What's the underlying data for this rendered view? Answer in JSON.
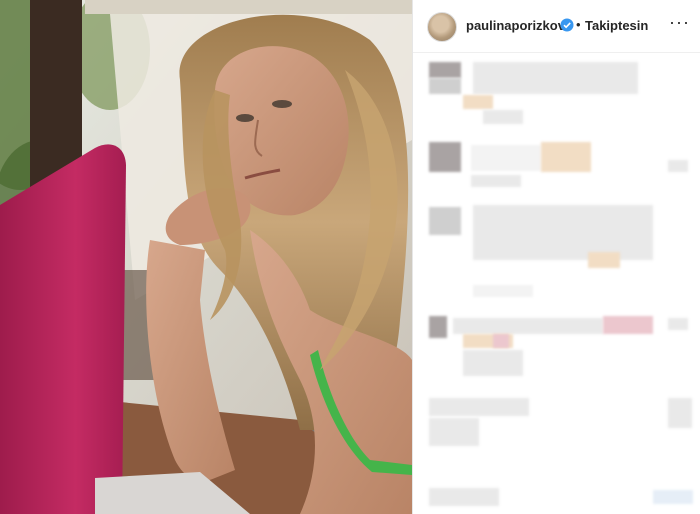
{
  "post": {
    "photo_alt": "Woman with wavy blonde hair resting chin on hand beside a pink laptop",
    "header": {
      "username": "paulinaporizkov",
      "verified_icon": "verified-badge-icon",
      "separator": "•",
      "follow_label": "Takiptesin",
      "more_icon": "more-options-icon",
      "more_label": "···"
    },
    "colors": {
      "verified": "#3897f0",
      "text": "#262626",
      "laptop": "#b8225a"
    },
    "comments_blurred": true
  }
}
